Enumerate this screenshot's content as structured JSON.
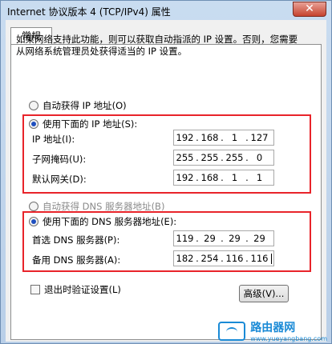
{
  "window": {
    "title": "Internet 协议版本 4 (TCP/IPv4) 属性",
    "close_glyph": "✕"
  },
  "tab": {
    "label": "常规"
  },
  "description": "如果网络支持此功能，则可以获取自动指派的 IP 设置。否则，您需要从网络系统管理员处获得适当的 IP 设置。",
  "ip_section": {
    "auto_label": "自动获得 IP 地址(O)",
    "manual_label": "使用下面的 IP 地址(S):",
    "fields": [
      {
        "label": "IP 地址(I):",
        "octets": [
          "192",
          "168",
          "1",
          "127"
        ]
      },
      {
        "label": "子网掩码(U):",
        "octets": [
          "255",
          "255",
          "255",
          "0"
        ]
      },
      {
        "label": "默认网关(D):",
        "octets": [
          "192",
          "168",
          "1",
          "1"
        ]
      }
    ]
  },
  "dns_section": {
    "auto_label": "自动获得 DNS 服务器地址(B)",
    "manual_label": "使用下面的 DNS 服务器地址(E):",
    "fields": [
      {
        "label": "首选 DNS 服务器(P):",
        "octets": [
          "119",
          "29",
          "29",
          "29"
        ]
      },
      {
        "label": "备用 DNS 服务器(A):",
        "octets": [
          "182",
          "254",
          "116",
          "116"
        ]
      }
    ]
  },
  "validate_label": "退出时验证设置(L)",
  "advanced_button": "高级(V)...",
  "watermark": {
    "text": "路由器网",
    "url": "www.yueyangbang.com"
  },
  "colors": {
    "highlight": "#e8242a",
    "radio_dot": "#1f4fbf",
    "watermark": "#1a8ad6"
  }
}
